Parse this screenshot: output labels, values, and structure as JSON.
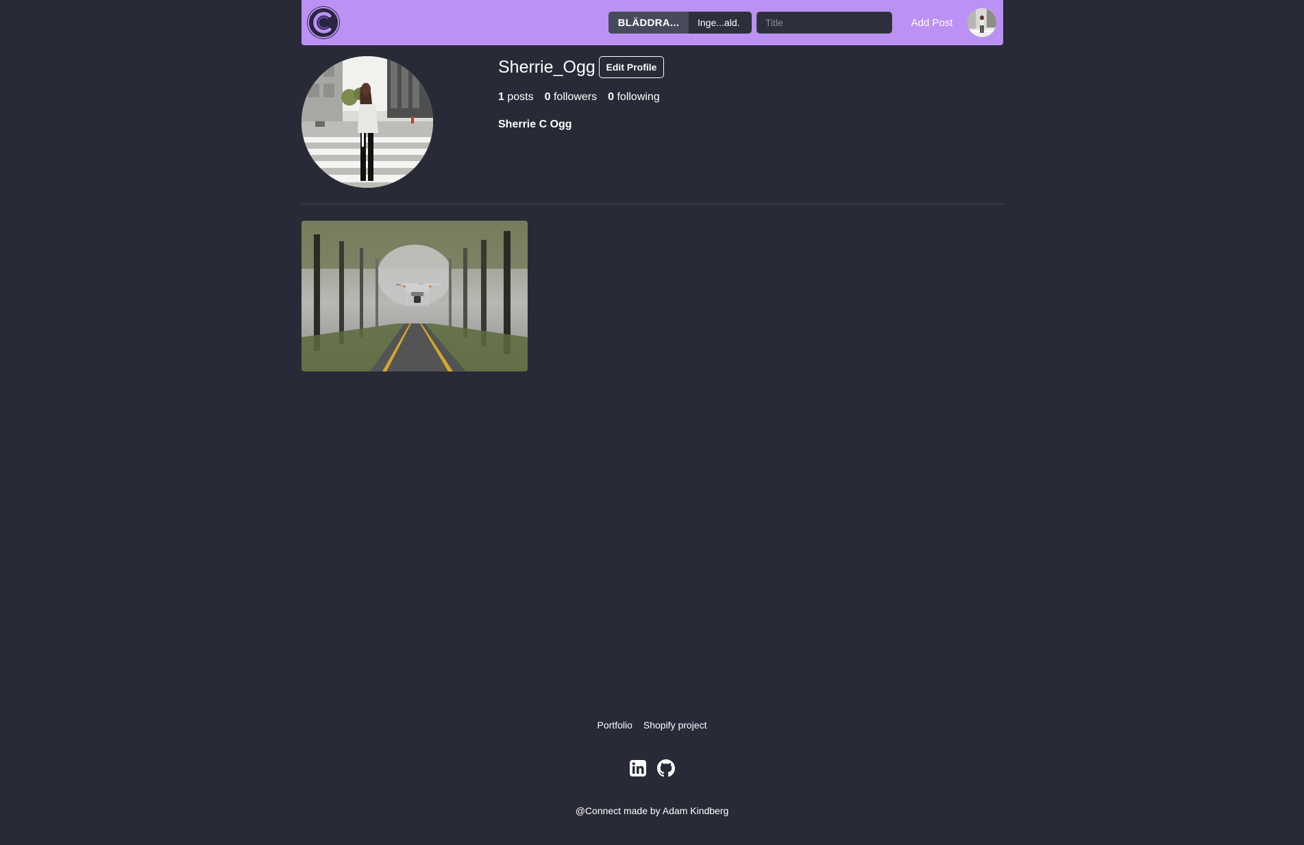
{
  "colors": {
    "background": "#282a37",
    "navbar": "#bb92f3",
    "input_bg": "#2d2f3c",
    "file_button_bg": "#474a5a"
  },
  "navbar": {
    "logo_icon": "connect-logo-icon",
    "file_button_label": "BLÄDDRA...",
    "file_name": "Inge...ald.",
    "title_placeholder": "Title",
    "add_post_label": "Add Post",
    "avatar_icon": "user-avatar"
  },
  "profile": {
    "username": "Sherrie_Ogg",
    "edit_button_label": "Edit Profile",
    "stats": {
      "posts_count": "1",
      "posts_label": "posts",
      "followers_count": "0",
      "followers_label": "followers",
      "following_count": "0",
      "following_label": "following"
    },
    "full_name": "Sherrie C Ogg"
  },
  "posts": [
    {
      "image": "drone-over-foggy-road-photo"
    }
  ],
  "footer": {
    "links": [
      "Portfolio",
      "Shopify project"
    ],
    "social_icons": [
      "linkedin-icon",
      "github-icon"
    ],
    "copyright": "@Connect made by Adam Kindberg"
  }
}
